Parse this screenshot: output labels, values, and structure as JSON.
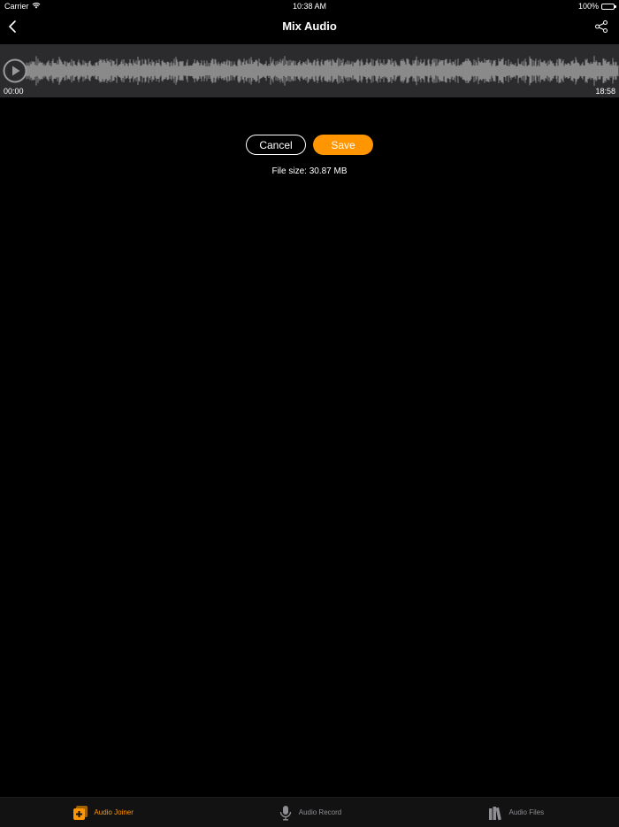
{
  "status": {
    "carrier": "Carrier",
    "time": "10:38 AM",
    "battery": "100%"
  },
  "nav": {
    "title": "Mix Audio",
    "back_icon": "chevron-left-icon",
    "share_icon": "share-icon"
  },
  "player": {
    "start_time": "00:00",
    "end_time": "18:58",
    "play_icon": "play-icon"
  },
  "actions": {
    "cancel_label": "Cancel",
    "save_label": "Save"
  },
  "file_size": "File size: 30.87 MB",
  "tabs": [
    {
      "label": "Audio Joiner",
      "icon": "audio-joiner-icon",
      "active": true
    },
    {
      "label": "Audio Record",
      "icon": "microphone-icon",
      "active": false
    },
    {
      "label": "Audio Files",
      "icon": "library-icon",
      "active": false
    }
  ],
  "colors": {
    "accent": "#ff9500",
    "background": "#000000",
    "wave_panel": "#2b2b2e",
    "waveform": "#8a8a8a",
    "inactive_tab": "#8e8e93"
  }
}
